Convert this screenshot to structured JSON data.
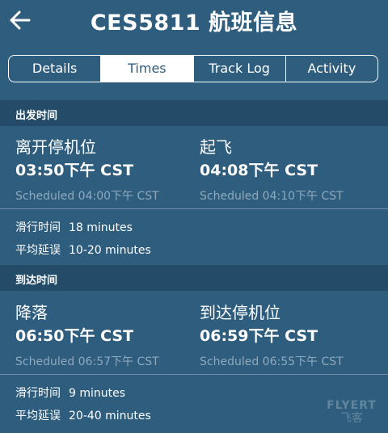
{
  "header": {
    "title": "CES5811 航班信息",
    "back_icon": "back-arrow-icon"
  },
  "tabs": [
    {
      "label": "Details",
      "active": false
    },
    {
      "label": "Times",
      "active": true
    },
    {
      "label": "Track Log",
      "active": false
    },
    {
      "label": "Activity",
      "active": false
    }
  ],
  "departure": {
    "section_title": "出发时间",
    "gate_out": {
      "label": "离开停机位",
      "time": "03:50下午 CST",
      "scheduled": "Scheduled  04:00下午 CST"
    },
    "takeoff": {
      "label": "起飞",
      "time": "04:08下午 CST",
      "scheduled": "Scheduled   04:10下午 CST"
    },
    "taxi": {
      "label": "滑行时间",
      "value": "18 minutes"
    },
    "avg_delay": {
      "label": "平均延误",
      "value": "10-20 minutes"
    }
  },
  "arrival": {
    "section_title": "到达时间",
    "landing": {
      "label": "降落",
      "time": "06:50下午 CST",
      "scheduled": "Scheduled  06:57下午 CST"
    },
    "gate_in": {
      "label": "到达停机位",
      "time": "06:59下午 CST",
      "scheduled": "Scheduled   06:55下午 CST"
    },
    "taxi": {
      "label": "滑行时间",
      "value": "9 minutes"
    },
    "avg_delay": {
      "label": "平均延误",
      "value": "20-40 minutes"
    }
  },
  "watermark": {
    "line1": "FLYERT",
    "line2": "飞客"
  },
  "colors": {
    "background": "#2e5d7e",
    "section_header": "#244c68",
    "muted_text": "#8ea9bd"
  }
}
